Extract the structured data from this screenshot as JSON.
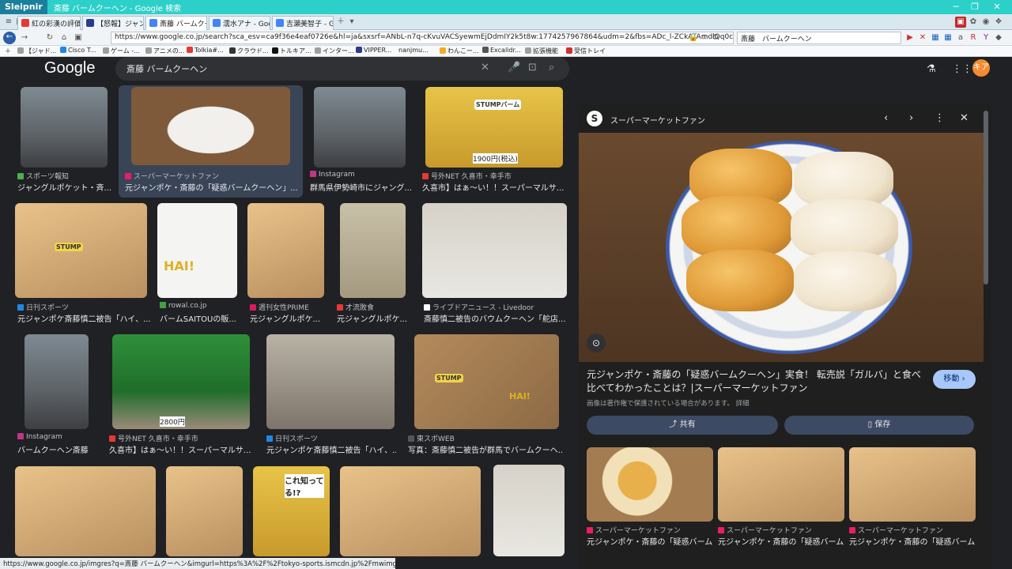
{
  "window": {
    "app": "Sleipnir",
    "title": "斎藤 バームクーヘン - Google 検索"
  },
  "tabs": [
    {
      "label": "紅の彩漢の評価..."
    },
    {
      "label": "【怒報】ジャンポケ..."
    },
    {
      "label": "斎藤 バームクー..."
    },
    {
      "label": "濡水アナ - Goog..."
    },
    {
      "label": "吉瀬美智子 - G..."
    }
  ],
  "address": {
    "url": "https://www.google.co.jp/search?sca_esv=ca9f36e4eaf0726e&hl=ja&sxsrf=ANbL-n7q-cKvuVACSyewmEjDdmIY2k5t8w:1774257967864&udm=2&fbs=ADc_l-ZCkATAmdlQq0cAq4f7K8zv4r1o6NSYxVidsZ7fDm8",
    "search_box": "斎藤　バームクーヘン"
  },
  "bookmarks": [
    "【ジャド...",
    "Cisco T...",
    "ゲーム -...",
    "アニメの...",
    "Tolkia#...",
    "クラウド...",
    "トルキア...",
    "インター...",
    "VIPPER...",
    "nanjmu...",
    "わんこー...",
    "Excalidr...",
    "拡張機能",
    "受信トレイ"
  ],
  "google": {
    "logo": "Google",
    "query": "斎藤 バームクーヘン",
    "avatar_initials": "キア"
  },
  "results": [
    {
      "source": "スポーツ報知",
      "title": "ジャングルポケット・斉...",
      "color": "#4caf50"
    },
    {
      "source": "スーパーマーケットファン",
      "title": "元ジャンポケ・斎藤の「疑惑バームクーヘン」...",
      "color": "#e91e63"
    },
    {
      "source": "Instagram",
      "title": "群馬県伊勢崎市にジャング...",
      "color": "#c13584"
    },
    {
      "source": "号外NET 久喜市・幸手市",
      "title": "久喜市】はぁ〜い！！スーパーマルサ...",
      "color": "#e53935"
    },
    {
      "source": "日刊スポーツ",
      "title": "元ジャンポケ斎藤慎二被告「ハイ、...",
      "color": "#1e88e5"
    },
    {
      "source": "rowal.co.jp",
      "title": "バームSAITOUの販...",
      "color": "#43a047"
    },
    {
      "source": "週刊女性PRIME",
      "title": "元ジャングルポケ...",
      "color": "#d81b60"
    },
    {
      "source": "才流敗食",
      "title": "元ジャングルポケ...",
      "color": "#e53935"
    },
    {
      "source": "ライブドアニュース - Livedoor",
      "title": "斎藤慎二被告のバウムクーヘン「舵店...",
      "color": "#ffffff"
    },
    {
      "source": "Instagram",
      "title": "バームクーヘン斎藤",
      "color": "#c13584"
    },
    {
      "source": "号外NET 久喜市・幸手市",
      "title": "久喜市】はぁ〜い！！スーパーマルサ...",
      "color": "#e53935"
    },
    {
      "source": "日刊スポーツ",
      "title": "元ジャンポケ斎藤慎二被告「ハイ、...",
      "color": "#1e88e5"
    },
    {
      "source": "東スポWEB",
      "title": "写真：斎藤慎二被告が群馬でバームクーヘ...",
      "color": "#555555"
    }
  ],
  "thumb_text": {
    "stump": "STUMP",
    "hai": "HAI!",
    "price1": "1900円(税込)",
    "price2": "2800円",
    "kore": "これ知ってる!?",
    "stump_bar": "STUMPバーム"
  },
  "panel": {
    "source": "スーパーマーケットファン",
    "source_logo": "S",
    "title": "元ジャンポケ・斎藤の「疑惑バームクーヘン」実食！ 転売説「ガルバ」と食べ比べてわかったことは？|スーパーマーケットファン",
    "visit": "移動",
    "note": "画像は著作権で保護されている場合があります。 詳細",
    "share": "共有",
    "save": "保存",
    "related": [
      {
        "source": "スーパーマーケットファン",
        "title": "元ジャンポケ・斎藤の「疑惑バームク..."
      },
      {
        "source": "スーパーマーケットファン",
        "title": "元ジャンポケ・斎藤の「疑惑バームク..."
      },
      {
        "source": "スーパーマーケットファン",
        "title": "元ジャンポケ・斎藤の「疑惑バームク..."
      }
    ]
  },
  "status_url": "https://www.google.co.jp/imgres?q=斎藤 バームクーヘン&imgurl=https%3A%2F%2Ftokyo-sports.ismcdn.jp%2Fmwimg..."
}
